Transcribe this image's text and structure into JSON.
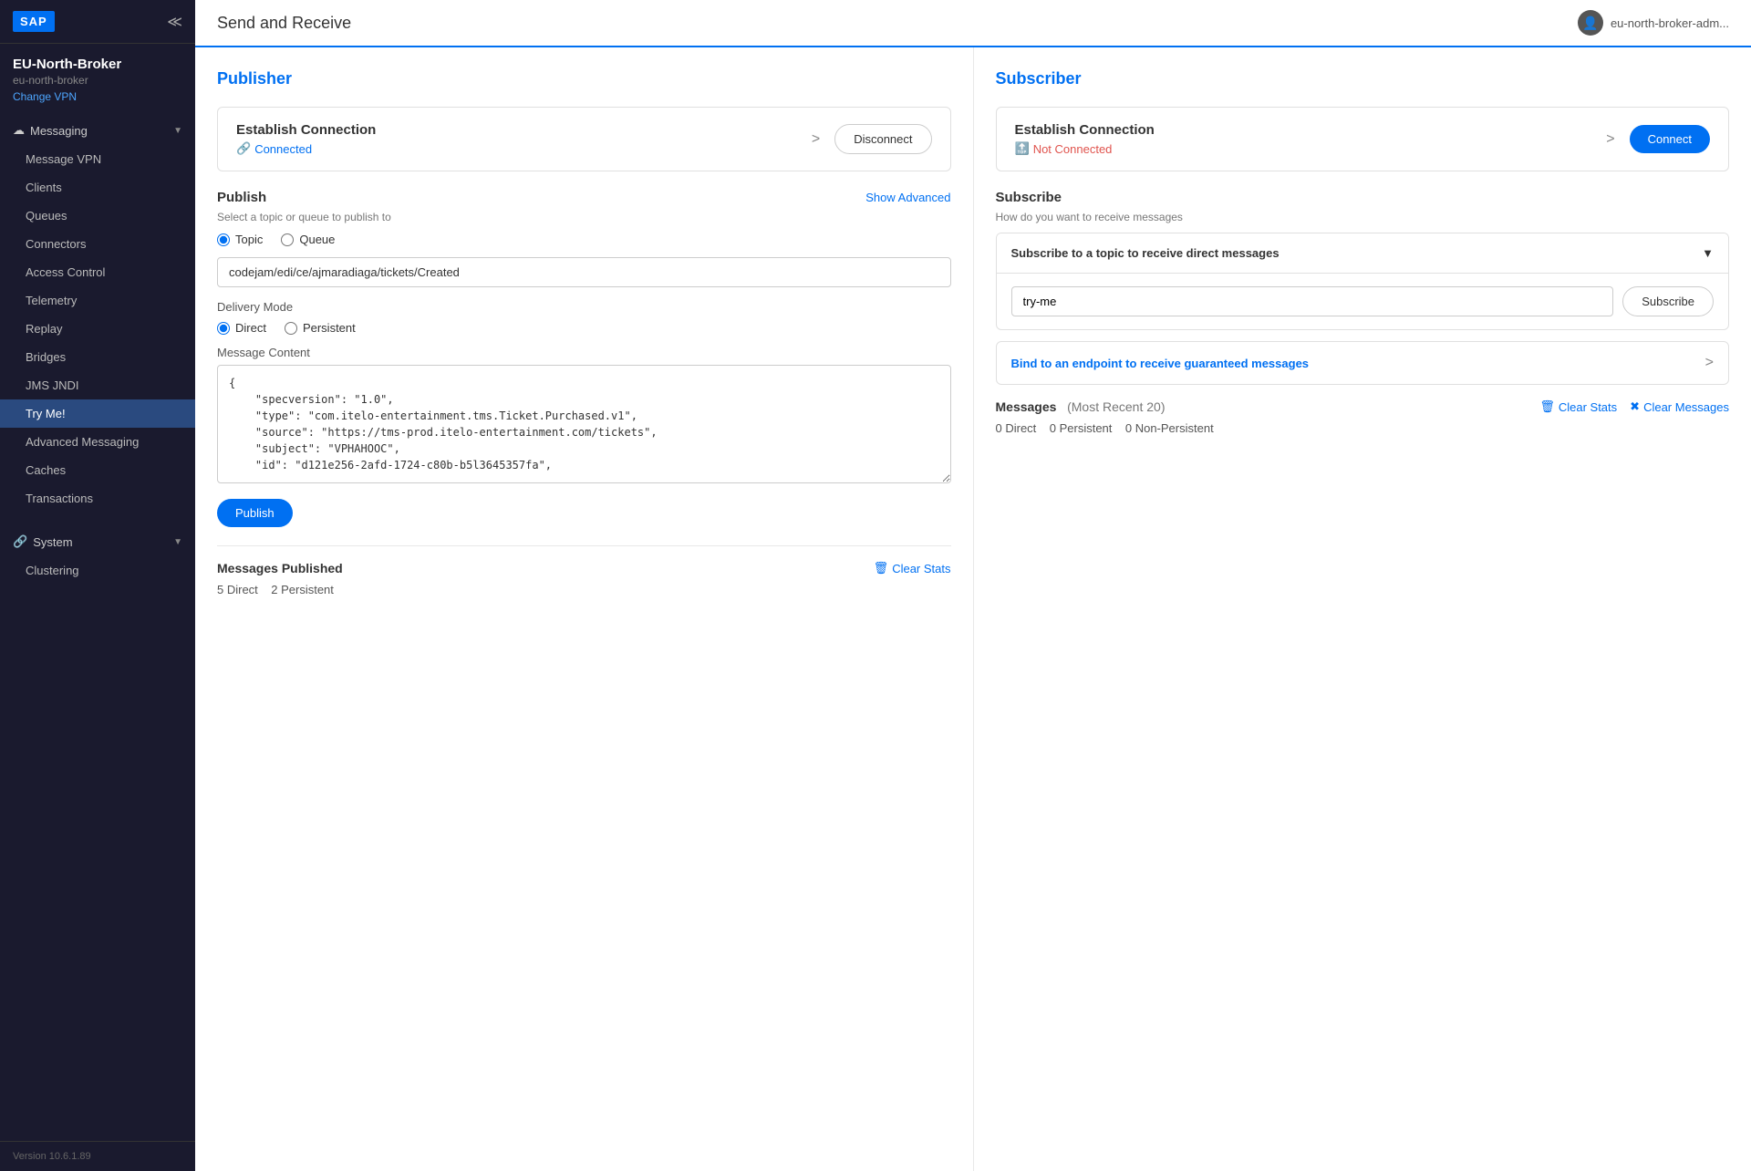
{
  "sidebar": {
    "logo": "SAP",
    "broker_name": "EU-North-Broker",
    "broker_id": "eu-north-broker",
    "change_vpn": "Change VPN",
    "messaging_section": "Messaging",
    "nav_items": [
      {
        "label": "Message VPN",
        "active": false
      },
      {
        "label": "Clients",
        "active": false
      },
      {
        "label": "Queues",
        "active": false
      },
      {
        "label": "Connectors",
        "active": false
      },
      {
        "label": "Access Control",
        "active": false
      },
      {
        "label": "Telemetry",
        "active": false
      },
      {
        "label": "Replay",
        "active": false
      },
      {
        "label": "Bridges",
        "active": false
      },
      {
        "label": "JMS JNDI",
        "active": false
      },
      {
        "label": "Try Me!",
        "active": true
      },
      {
        "label": "Advanced Messaging",
        "active": false
      },
      {
        "label": "Caches",
        "active": false
      },
      {
        "label": "Transactions",
        "active": false
      }
    ],
    "system_section": "System",
    "system_items": [
      {
        "label": "Clustering",
        "active": false
      }
    ],
    "version": "Version 10.6.1.89"
  },
  "topbar": {
    "title": "Send and Receive",
    "user": "eu-north-broker-adm..."
  },
  "publisher": {
    "title": "Publisher",
    "connection_title": "Establish Connection",
    "connection_status": "Connected",
    "disconnect_label": "Disconnect",
    "publish_title": "Publish",
    "publish_subtitle": "Select a topic or queue to publish to",
    "show_advanced": "Show Advanced",
    "topic_label": "Topic",
    "queue_label": "Queue",
    "topic_selected": true,
    "topic_value": "codejam/edi/ce/ajmaradiaga/tickets/Created",
    "delivery_mode_label": "Delivery Mode",
    "direct_label": "Direct",
    "persistent_label": "Persistent",
    "direct_selected": true,
    "message_content_label": "Message Content",
    "message_content": "{\n    \"specversion\": \"1.0\",\n    \"type\": \"com.itelo-entertainment.tms.Ticket.Purchased.v1\",\n    \"source\": \"https://tms-prod.itelo-entertainment.com/tickets\",\n    \"subject\": \"VPHAHOOC\",\n    \"id\": \"d121e256-2afd-1724-c80b-b5l3645357fa\",",
    "publish_button": "Publish",
    "messages_published_title": "Messages Published",
    "clear_stats_label": "Clear Stats",
    "direct_count": "5 Direct",
    "persistent_count": "2 Persistent"
  },
  "subscriber": {
    "title": "Subscriber",
    "connection_title": "Establish Connection",
    "connection_status": "Not Connected",
    "connect_label": "Connect",
    "subscribe_title": "Subscribe",
    "subscribe_subtitle": "How do you want to receive messages",
    "accordion_title": "Subscribe to a topic to receive direct messages",
    "subscribe_input_value": "try-me",
    "subscribe_button": "Subscribe",
    "bind_endpoint_title": "Bind to an endpoint to receive guaranteed messages",
    "messages_title": "Messages",
    "messages_subtitle": "(Most Recent 20)",
    "clear_stats_label": "Clear Stats",
    "clear_messages_label": "Clear Messages",
    "direct_count": "0 Direct",
    "persistent_count": "0 Persistent",
    "non_persistent_count": "0 Non-Persistent"
  }
}
